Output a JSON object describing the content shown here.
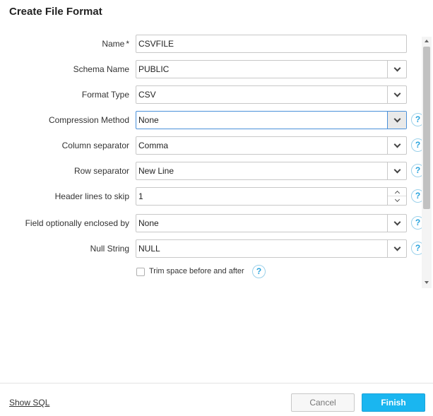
{
  "dialog": {
    "title": "Create File Format"
  },
  "form": {
    "name": {
      "label": "Name",
      "required_mark": "*",
      "value": "CSVFILE"
    },
    "schema_name": {
      "label": "Schema Name",
      "value": "PUBLIC"
    },
    "format_type": {
      "label": "Format Type",
      "value": "CSV"
    },
    "compression_method": {
      "label": "Compression Method",
      "value": "None",
      "help": "?"
    },
    "column_separator": {
      "label": "Column separator",
      "value": "Comma",
      "help": "?"
    },
    "row_separator": {
      "label": "Row separator",
      "value": "New Line",
      "help": "?"
    },
    "header_lines": {
      "label": "Header lines to skip",
      "value": "1",
      "help": "?"
    },
    "field_enclosed": {
      "label": "Field optionally enclosed by",
      "value": "None",
      "help": "?"
    },
    "null_string": {
      "label": "Null String",
      "value": "NULL",
      "help": "?"
    },
    "trim_space": {
      "label": "Trim space before and after",
      "checked": false,
      "help": "?"
    }
  },
  "footer": {
    "show_sql": "Show SQL",
    "cancel": "Cancel",
    "finish": "Finish"
  },
  "colors": {
    "accent": "#1ab6f0",
    "focus_border": "#4a90d9",
    "help_icon": "#29a3dd"
  }
}
